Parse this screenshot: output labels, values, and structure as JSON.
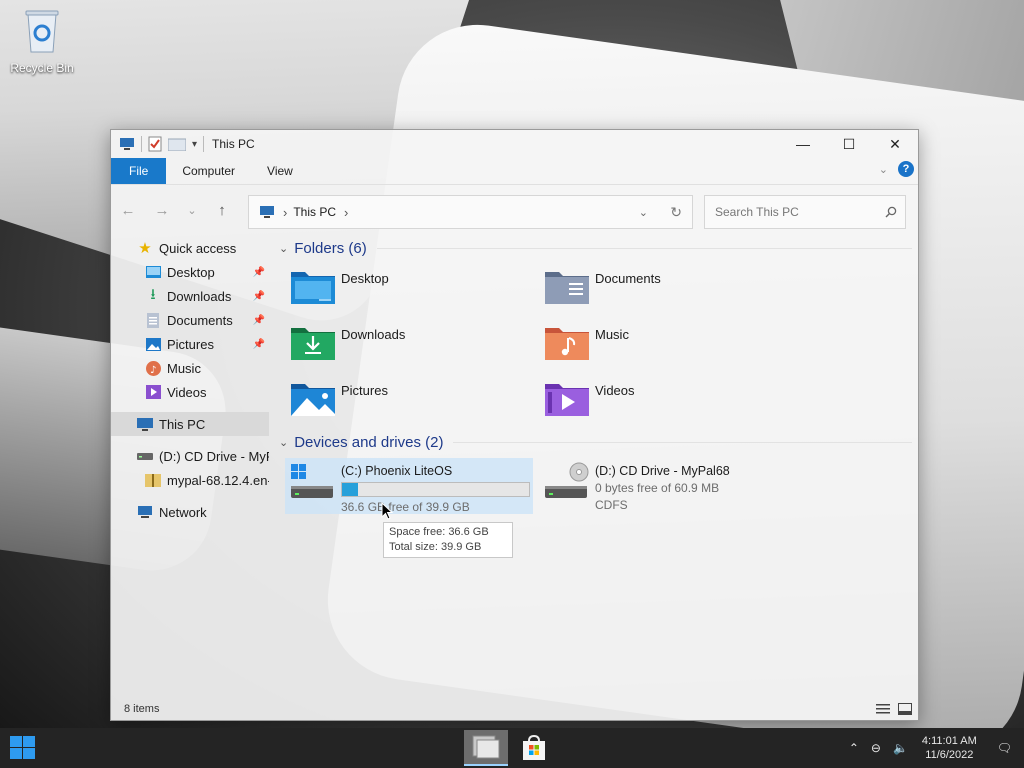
{
  "desktop": {
    "icons": [
      {
        "label": "Recycle Bin",
        "icon": "recycle-bin-icon"
      }
    ]
  },
  "window": {
    "title": "This PC",
    "controls": {
      "minimize": "—",
      "maximize": "☐",
      "close": "✕"
    },
    "ribbon": {
      "tabs": [
        "File",
        "Computer",
        "View"
      ]
    },
    "navigation": {
      "back": "←",
      "forward": "→",
      "recent": "⌄",
      "up": "↑"
    },
    "address": {
      "location": "This PC",
      "separator": "›"
    },
    "search": {
      "placeholder": "Search This PC"
    },
    "nav_pane": {
      "quick_access": "Quick access",
      "pinned": [
        {
          "label": "Desktop",
          "icon": "desktop-folder-icon",
          "pinned": true
        },
        {
          "label": "Downloads",
          "icon": "downloads-folder-icon",
          "pinned": true
        },
        {
          "label": "Documents",
          "icon": "documents-folder-icon",
          "pinned": true
        },
        {
          "label": "Pictures",
          "icon": "pictures-folder-icon",
          "pinned": true
        },
        {
          "label": "Music",
          "icon": "music-folder-icon",
          "pinned": false
        },
        {
          "label": "Videos",
          "icon": "videos-folder-icon",
          "pinned": false
        }
      ],
      "this_pc": "This PC",
      "cd_drive": "(D:) CD Drive - MyP",
      "archive": "mypal-68.12.4.en-",
      "network": "Network"
    },
    "folders": {
      "header": "Folders (6)",
      "items": [
        {
          "label": "Desktop",
          "icon": "desktop-folder-icon",
          "color": "#1d8bd6"
        },
        {
          "label": "Documents",
          "icon": "documents-folder-icon",
          "color": "#7a8aa6"
        },
        {
          "label": "Downloads",
          "icon": "downloads-folder-icon",
          "color": "#1f9a5a"
        },
        {
          "label": "Music",
          "icon": "music-folder-icon",
          "color": "#e0704a"
        },
        {
          "label": "Pictures",
          "icon": "pictures-folder-icon",
          "color": "#1e78c8"
        },
        {
          "label": "Videos",
          "icon": "videos-folder-icon",
          "color": "#8a4fcf"
        }
      ]
    },
    "drives": {
      "header": "Devices and drives (2)",
      "items": [
        {
          "name": "(C:) Phoenix LiteOS",
          "free_text": "36.6 GB free of 39.9 GB",
          "used_fraction": 0.083,
          "icon": "windows-drive-icon"
        },
        {
          "name": "(D:) CD Drive - MyPal68",
          "free_text": "0 bytes free of 60.9 MB",
          "fs": "CDFS",
          "icon": "cd-drive-icon"
        }
      ]
    },
    "tooltip": {
      "space_free": "Space free: 36.6 GB",
      "total_size": "Total size: 39.9 GB"
    },
    "status": {
      "items": "8 items"
    },
    "accent_color": "#1979ca"
  },
  "taskbar": {
    "apps": [
      {
        "icon": "file-explorer-icon",
        "active": true
      },
      {
        "icon": "store-icon",
        "active": false
      }
    ],
    "tray": {
      "time": "4:11:01 AM",
      "date": "11/6/2022"
    }
  }
}
